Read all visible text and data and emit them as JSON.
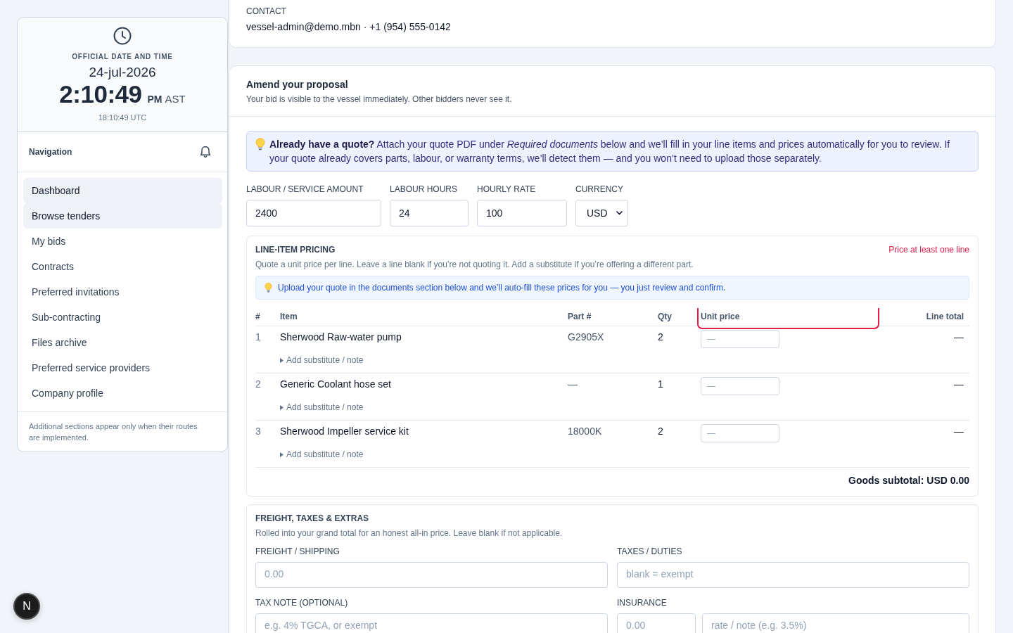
{
  "sidebar": {
    "clock": {
      "caption": "OFFICIAL DATE AND TIME",
      "date": "24-jul-2026",
      "time": "2:10:49",
      "meridiem": "PM",
      "zone": "AST",
      "utc": "18:10:49 UTC"
    },
    "nav_title": "Navigation",
    "items": [
      {
        "label": "Dashboard",
        "selected": true
      },
      {
        "label": "Browse tenders",
        "selected": true
      },
      {
        "label": "My bids",
        "selected": false
      },
      {
        "label": "Contracts",
        "selected": false
      },
      {
        "label": "Preferred invitations",
        "selected": false
      },
      {
        "label": "Sub-contracting",
        "selected": false
      },
      {
        "label": "Files archive",
        "selected": false
      },
      {
        "label": "Preferred service providers",
        "selected": false
      },
      {
        "label": "Company profile",
        "selected": false
      }
    ],
    "footnote": "Additional sections appear only when their routes are implemented."
  },
  "contact": {
    "label": "CONTACT",
    "value": "vessel-admin@demo.mbn · +1 (954) 555-0142"
  },
  "proposal": {
    "title": "Amend your proposal",
    "subtitle": "Your bid is visible to the vessel immediately. Other bidders never see it.",
    "banner": "**Already have a quote?** Attach your quote PDF under *Required documents* below and we’ll fill in your line items and prices automatically for you to review. If your quote already covers parts, labour, or warranty terms, we’ll detect them — and you won’t need to upload those separately.",
    "fields": [
      {
        "kind": "input",
        "label": "LABOUR / SERVICE AMOUNT",
        "value": "2400"
      },
      {
        "kind": "input",
        "label": "LABOUR HOURS",
        "value": "24"
      },
      {
        "kind": "input",
        "label": "HOURLY RATE",
        "value": "100"
      },
      {
        "kind": "select",
        "label": "CURRENCY",
        "value": "USD"
      }
    ],
    "line_items": {
      "title": "LINE-ITEM PRICING",
      "requirement": "Price at least one line",
      "subtitle": "Quote a unit price per line. Leave a line blank if you’re not quoting it. Add a substitute if you’re offering a different part.",
      "hint": "Upload your quote in the documents section below and we’ll auto-fill these prices for you — you just review and confirm.",
      "columns": [
        {
          "label": "#",
          "highlighted": false
        },
        {
          "label": "Item",
          "highlighted": false
        },
        {
          "label": "Part #",
          "highlighted": false
        },
        {
          "label": "Qty",
          "highlighted": false
        },
        {
          "label": "Unit price",
          "highlighted": true
        },
        {
          "label": "Line total",
          "highlighted": false
        }
      ],
      "rows": [
        {
          "number": "1",
          "item": "Sherwood Raw-water pump",
          "part": "G2905X",
          "qty": "2",
          "unit_price_placeholder": "—",
          "line_total": "—",
          "toggle": "Add substitute / note"
        },
        {
          "number": "2",
          "item": "Generic Coolant hose set",
          "part": "—",
          "qty": "1",
          "unit_price_placeholder": "—",
          "line_total": "—",
          "toggle": "Add substitute / note"
        },
        {
          "number": "3",
          "item": "Sherwood Impeller service kit",
          "part": "18000K",
          "qty": "2",
          "unit_price_placeholder": "—",
          "line_total": "—",
          "toggle": "Add substitute / note"
        }
      ],
      "subtotal": "Goods subtotal: USD 0.00"
    },
    "extras": {
      "title": "FREIGHT, TAXES & EXTRAS",
      "subtitle": "Rolled into your grand total for an honest all-in price. Leave blank if not applicable.",
      "fields": [
        {
          "label": "FREIGHT / SHIPPING",
          "inputs": [
            {
              "placeholder": "0.00"
            }
          ]
        },
        {
          "label": "TAXES / DUTIES",
          "inputs": [
            {
              "placeholder": "blank = exempt"
            }
          ]
        },
        {
          "label": "TAX NOTE (OPTIONAL)",
          "inputs": [
            {
              "placeholder": "e.g. 4% TGCA, or exempt"
            }
          ]
        },
        {
          "label": "INSURANCE",
          "inputs": [
            {
              "placeholder": "0.00"
            },
            {
              "placeholder": "rate / note (e.g. 3.5%)"
            }
          ]
        }
      ]
    }
  },
  "dev_indicator": {
    "label": "N"
  }
}
